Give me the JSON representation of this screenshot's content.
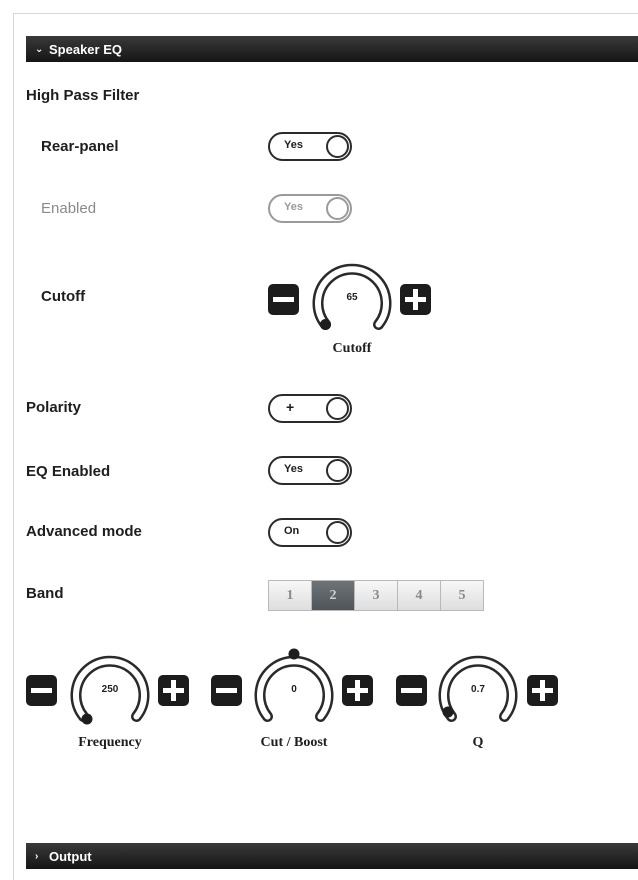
{
  "sections": {
    "speaker_eq": {
      "title": "Speaker EQ",
      "expanded": true
    },
    "output": {
      "title": "Output",
      "expanded": false
    }
  },
  "high_pass_filter": {
    "heading": "High Pass Filter",
    "rear_panel": {
      "label": "Rear-panel",
      "value": "Yes"
    },
    "enabled": {
      "label": "Enabled",
      "value": "Yes",
      "disabled": true
    },
    "cutoff": {
      "label": "Cutoff",
      "knob_value": "65",
      "knob_caption": "Cutoff"
    }
  },
  "polarity": {
    "label": "Polarity",
    "value": "+"
  },
  "eq_enabled": {
    "label": "EQ Enabled",
    "value": "Yes"
  },
  "advanced_mode": {
    "label": "Advanced mode",
    "value": "On"
  },
  "band": {
    "label": "Band",
    "options": [
      "1",
      "2",
      "3",
      "4",
      "5"
    ],
    "selected": "2"
  },
  "knobs": {
    "frequency": {
      "value": "250",
      "caption": "Frequency"
    },
    "cut_boost": {
      "value": "0",
      "caption": "Cut / Boost"
    },
    "q": {
      "value": "0.7",
      "caption": "Q"
    }
  },
  "icons": {
    "expanded": "chevron-down-icon",
    "collapsed": "chevron-right-icon",
    "decrement": "minus-icon",
    "increment": "plus-icon"
  },
  "colors": {
    "header_bg": "#1e1e1e",
    "active_band": "#5f6468",
    "button_dark": "#1c1c1c"
  }
}
